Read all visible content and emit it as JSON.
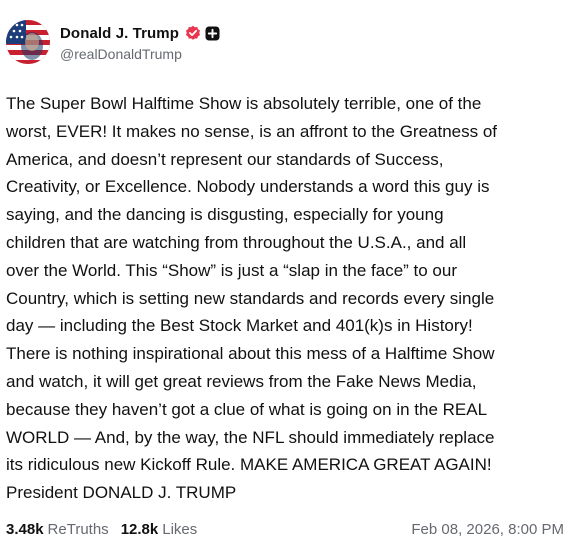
{
  "post": {
    "author": {
      "display_name": "Donald J. Trump",
      "handle": "@realDonaldTrump",
      "verified_badge_icon": "verified-check-icon",
      "extra_badge_icon": "plus-badge-icon",
      "avatar_icon": "flag-portrait-avatar",
      "verified_color": "#e8364f"
    },
    "body_lines": [
      "The Super Bowl Halftime Show is absolutely terrible, one of the",
      "worst, EVER! It makes no sense, is an affront to the Greatness of",
      "America, and doesn’t represent our standards of Success,",
      "Creativity, or Excellence. Nobody understands a word this guy is",
      "saying, and the dancing is disgusting, especially for young",
      "children that are watching from throughout the U.S.A., and all",
      "over the World. This “Show” is just a “slap in the face” to our",
      "Country, which is setting new standards and records every single",
      "day — including the Best Stock Market and 401(k)s in History!",
      "There is nothing inspirational about this mess of a Halftime Show",
      "and watch, it will get great reviews from the Fake News Media,",
      "because they haven’t got a clue of what is going on in the REAL",
      "WORLD — And, by the way, the NFL should immediately replace",
      "its ridiculous new Kickoff Rule. MAKE AMERICA GREAT AGAIN!",
      "President DONALD J. TRUMP"
    ],
    "stats": {
      "retruths_count": "3.48k",
      "retruths_label": "ReTruths",
      "likes_count": "12.8k",
      "likes_label": "Likes"
    },
    "timestamp": "Feb 08, 2026, 8:00 PM"
  },
  "colors": {
    "text_primary": "#111111",
    "text_secondary": "#666a70",
    "badge_red": "#e8364f"
  }
}
